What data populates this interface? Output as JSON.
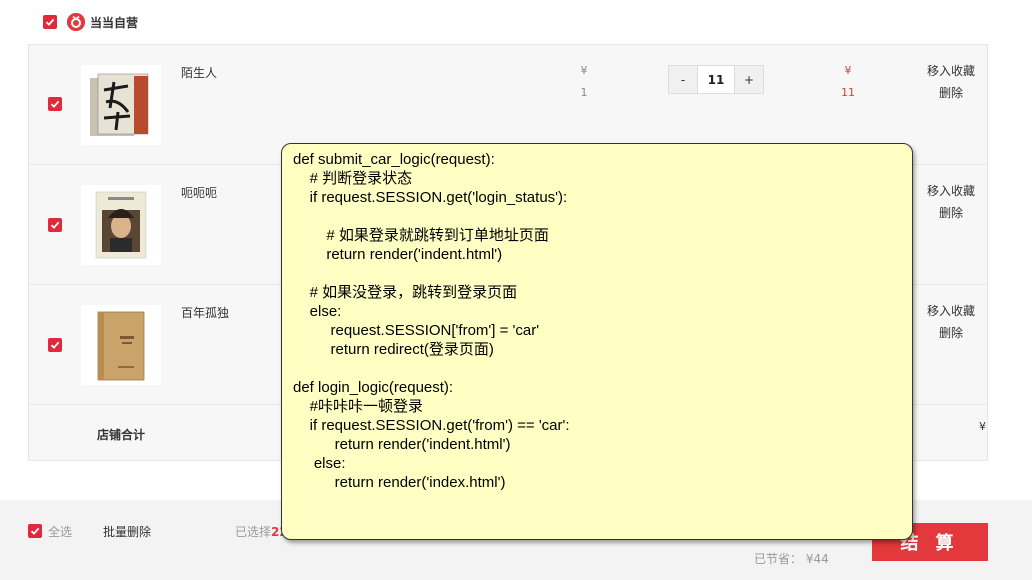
{
  "shop": {
    "name": "当当自营",
    "logo_icon": "dangdang-logo-icon"
  },
  "items": [
    {
      "name": "陌生人",
      "unit_price_symbol": "¥",
      "unit_price": "1",
      "quantity": "11",
      "subtotal_symbol": "¥",
      "subtotal": "11",
      "fav_label": "移入收藏",
      "delete_label": "删除"
    },
    {
      "name": "呃呃呃",
      "fav_label": "移入收藏",
      "delete_label": "删除"
    },
    {
      "name": "百年孤独",
      "fav_label": "移入收藏",
      "delete_label": "删除"
    }
  ],
  "stepper": {
    "minus": "-",
    "plus": "+"
  },
  "shop_total": {
    "label": "店铺合计",
    "currency": "¥"
  },
  "bottom": {
    "select_all": "全选",
    "batch_delete": "批量删除",
    "selected_prefix": "已选择",
    "selected_num": "22",
    "saved_label": "已节省：",
    "saved_value": "¥44",
    "checkout_label": "结 算"
  },
  "code_note": {
    "lines": [
      "def submit_car_logic(request):",
      "    # 判断登录状态",
      "    if request.SESSION.get('login_status'):",
      "",
      "        # 如果登录就跳转到订单地址页面",
      "        return render('indent.html')",
      "",
      "    # 如果没登录，跳转到登录页面",
      "    else:",
      "         request.SESSION['from'] = 'car'",
      "         return redirect(登录页面)",
      "",
      "def login_logic(request):",
      "    #咔咔咔一顿登录",
      "    if request.SESSION.get('from') == 'car':",
      "          return render('indent.html')",
      "     else:",
      "          return render('index.html')"
    ]
  },
  "colors": {
    "accent": "#e4393c",
    "note_bg": "#ffffc4",
    "panel_bg": "#f7f7f7"
  }
}
